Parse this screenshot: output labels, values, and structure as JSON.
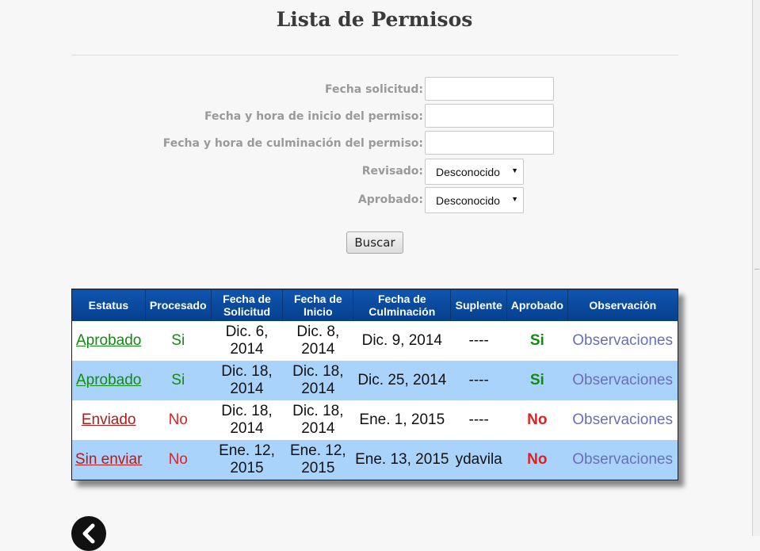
{
  "page": {
    "title": "Lista de Permisos"
  },
  "form": {
    "fecha_solicitud_label": "Fecha solicitud:",
    "fecha_inicio_label": "Fecha y hora de inicio del permiso:",
    "fecha_culminacion_label": "Fecha y hora de culminación del permiso:",
    "revisado_label": "Revisado:",
    "revisado_value": "Desconocido",
    "aprobado_label": "Aprobado:",
    "aprobado_value": "Desconocido",
    "buscar_label": "Buscar"
  },
  "table": {
    "headers": [
      "Estatus",
      "Procesado",
      "Fecha de Solicitud",
      "Fecha de Inicio",
      "Fecha de Culminación",
      "Suplente",
      "Aprobado",
      "Observación"
    ],
    "rows": [
      {
        "estatus": "Aprobado",
        "procesado": "Si",
        "solicitud": "Dic. 6, 2014",
        "inicio": "Dic. 8, 2014",
        "culminacion": "Dic. 9, 2014",
        "suplente": "----",
        "aprobado": "Si",
        "observacion": "Observaciones"
      },
      {
        "estatus": "Aprobado",
        "procesado": "Si",
        "solicitud": "Dic. 18, 2014",
        "inicio": "Dic. 18, 2014",
        "culminacion": "Dic. 25, 2014",
        "suplente": "----",
        "aprobado": "Si",
        "observacion": "Observaciones"
      },
      {
        "estatus": "Enviado",
        "procesado": "No",
        "solicitud": "Dic. 18, 2014",
        "inicio": "Dic. 18, 2014",
        "culminacion": "Ene. 1, 2015",
        "suplente": "----",
        "aprobado": "No",
        "observacion": "Observaciones"
      },
      {
        "estatus": "Sin enviar",
        "procesado": "No",
        "solicitud": "Ene. 12, 2015",
        "inicio": "Ene. 12, 2015",
        "culminacion": "Ene. 13, 2015",
        "suplente": "ydavila",
        "aprobado": "No",
        "observacion": "Observaciones"
      }
    ]
  },
  "icons": {
    "back": "back-arrow-icon"
  },
  "colors": {
    "header_bg": "#0a4a9e",
    "row_alt": "#a9d3fb",
    "yes": "#138a13",
    "no": "#e02020",
    "link": "#6a6fb8"
  }
}
